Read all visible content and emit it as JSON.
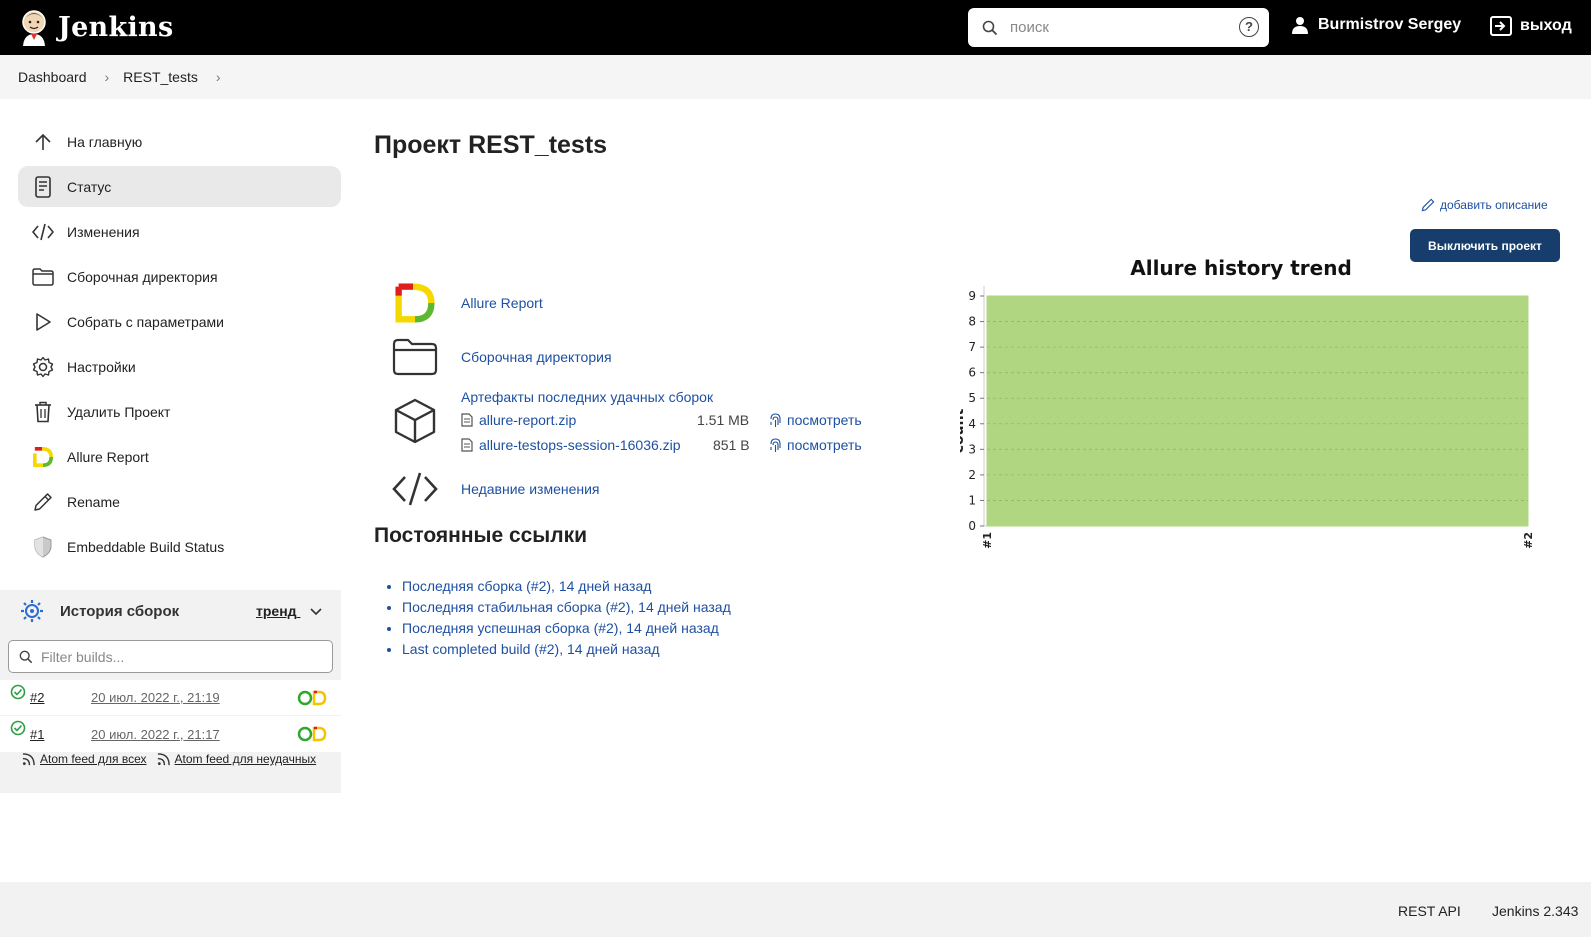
{
  "header": {
    "app_name": "Jenkins",
    "search_placeholder": "поиск",
    "help": "?",
    "user_name": "Burmistrov Sergey",
    "logout_label": "выход"
  },
  "breadcrumbs": [
    "Dashboard",
    "REST_tests"
  ],
  "sidebar": {
    "items": [
      {
        "label": "На главную",
        "icon": "arrow-up-icon"
      },
      {
        "label": "Статус",
        "icon": "document-icon",
        "active": true
      },
      {
        "label": "Изменения",
        "icon": "code-icon"
      },
      {
        "label": "Сборочная директория",
        "icon": "folder-icon"
      },
      {
        "label": "Собрать с параметрами",
        "icon": "play-icon"
      },
      {
        "label": "Настройки",
        "icon": "gear-icon"
      },
      {
        "label": "Удалить Проект",
        "icon": "trash-icon"
      },
      {
        "label": "Allure Report",
        "icon": "allure-icon"
      },
      {
        "label": "Rename",
        "icon": "pencil-icon"
      },
      {
        "label": "Embeddable Build Status",
        "icon": "shield-icon"
      }
    ]
  },
  "build_history": {
    "title": "История сборок",
    "trend_label": "тренд",
    "filter_placeholder": "Filter builds...",
    "builds": [
      {
        "number": "#2",
        "date": "20 июл. 2022 г., 21:19"
      },
      {
        "number": "#1",
        "date": "20 июл. 2022 г., 21:17"
      }
    ],
    "feed_all": "Atom feed для всех",
    "feed_failed": "Atom feed для неудачных"
  },
  "main": {
    "title": "Проект REST_tests",
    "add_description": "добавить описание",
    "disable_button": "Выключить проект",
    "links": {
      "allure": "Allure Report",
      "workspace": "Сборочная директория",
      "artifacts": "Артефакты последних удачных сборок",
      "changes": "Недавние изменения"
    },
    "artifacts": [
      {
        "name": "allure-report.zip",
        "size": "1.51 MB",
        "view": "посмотреть"
      },
      {
        "name": "allure-testops-session-16036.zip",
        "size": "851 B",
        "view": "посмотреть"
      }
    ],
    "permalinks_title": "Постоянные ссылки",
    "permalinks": [
      "Последняя сборка (#2), 14 дней назад",
      "Последняя стабильная сборка (#2), 14 дней назад",
      "Последняя успешная сборка (#2), 14 дней назад",
      "Last completed build (#2), 14 дней назад"
    ]
  },
  "chart_data": {
    "type": "area",
    "title": "Allure history trend",
    "ylabel": "count",
    "x": [
      "#1",
      "#2"
    ],
    "series": [
      {
        "values": [
          9,
          9
        ],
        "color": "#b0d682"
      }
    ],
    "ylim": [
      0,
      9
    ],
    "yticks": [
      0,
      1,
      2,
      3,
      4,
      5,
      6,
      7,
      8,
      9
    ],
    "grid": true
  },
  "footer": {
    "rest_api": "REST API",
    "version": "Jenkins 2.343"
  },
  "colors": {
    "header_bg": "#000000",
    "link": "#1e50a2",
    "button_bg": "#163d6b",
    "chart_fill": "#b0d682",
    "success": "#2e9e44"
  }
}
